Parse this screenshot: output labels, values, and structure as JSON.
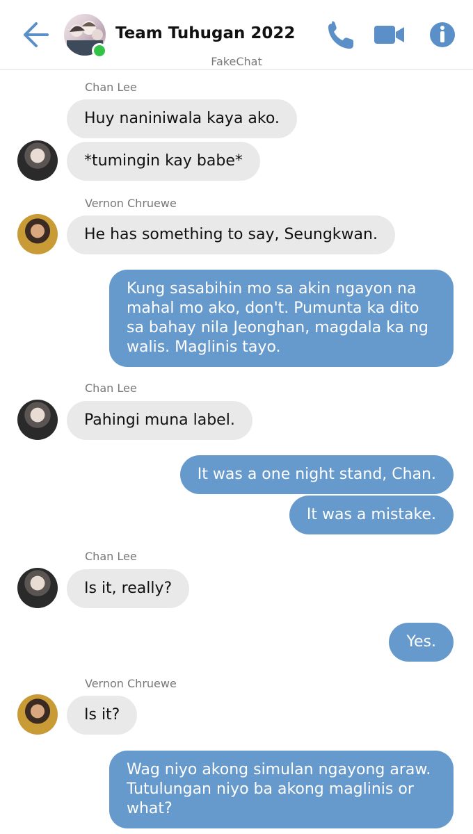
{
  "header": {
    "title": "Team Tuhugan 2022",
    "subtitle": "FakeChat",
    "icons": [
      "back-arrow-icon",
      "phone-icon",
      "video-camera-icon",
      "info-icon"
    ],
    "colors": {
      "accent": "#5b8fc7",
      "online": "#35c347"
    }
  },
  "messages": [
    {
      "sender": "Chan Lee",
      "text": "Huy naniniwala kaya ako."
    },
    {
      "text": "*tumingin kay babe*"
    },
    {
      "sender": "Vernon Chruewe",
      "text": "He has something to say, Seungkwan."
    },
    {
      "text": "Kung sasabihin mo sa akin ngayon na mahal mo ako, don't. Pumunta ka dito sa bahay nila Jeonghan, magdala ka ng walis. Maglinis tayo."
    },
    {
      "sender": "Chan Lee",
      "text": "Pahingi muna label."
    },
    {
      "text": "It was a one night stand, Chan."
    },
    {
      "text": "It was a mistake."
    },
    {
      "sender": "Chan Lee",
      "text": "Is it, really?"
    },
    {
      "text": "Yes."
    },
    {
      "sender": "Vernon Chruewe",
      "text": "Is it?"
    },
    {
      "text": "Wag niyo akong simulan ngayong araw. Tutulungan niyo ba akong maglinis or what?"
    }
  ],
  "colors": {
    "incoming_bubble": "#e9e9e9",
    "outgoing_bubble": "#6699cc"
  }
}
